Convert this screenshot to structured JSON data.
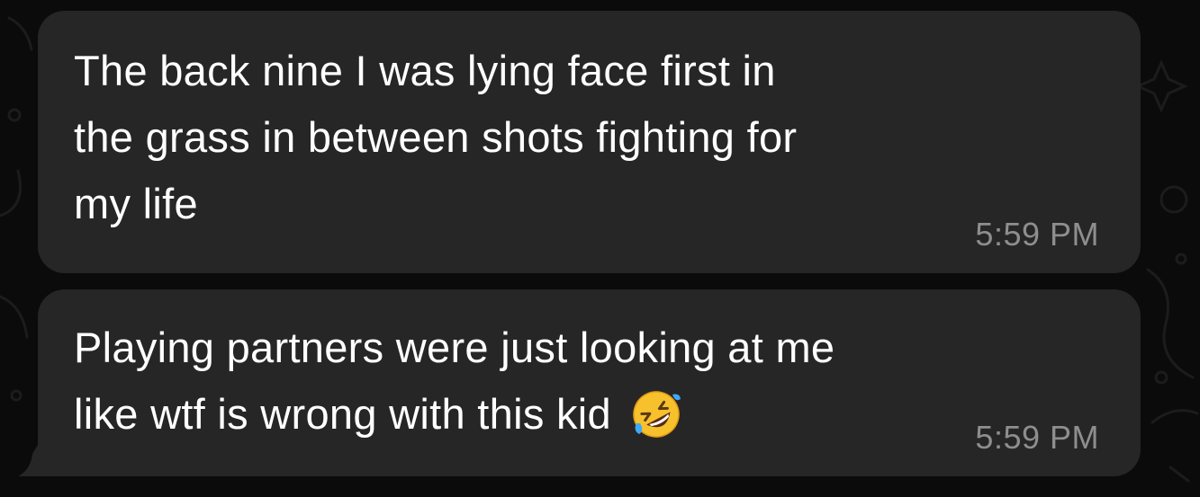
{
  "colors": {
    "background": "#0b0b0b",
    "bubble": "#262626",
    "text": "#ffffff",
    "timestamp": "#8e8e8e"
  },
  "messages": [
    {
      "text": "The back nine I was lying face first in\nthe grass in between shots fighting for\nmy life",
      "time": "5:59 PM"
    },
    {
      "text": "Playing partners were just looking at me\nlike wtf is wrong with this kid",
      "emoji": "rolling-on-floor-laughing-emoji",
      "time": "5:59 PM"
    }
  ]
}
